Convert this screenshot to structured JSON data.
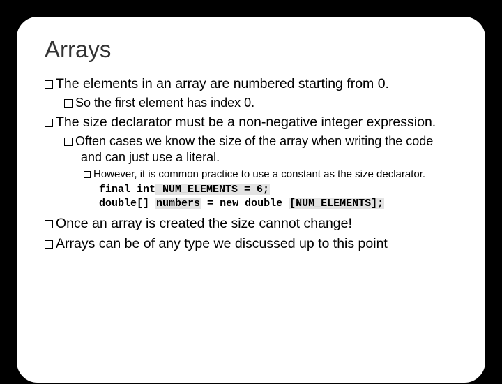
{
  "title": "Arrays",
  "items": {
    "p1": "The elements in an array are numbered starting from 0.",
    "p1a": "So the first element has index 0.",
    "p2": "The size declarator must be a non-negative integer expression.",
    "p2a": "Often cases we know the size of the array when writing the code and can just use a literal.",
    "p2a1": "However, it is common practice to use a constant as the size declarator.",
    "p3": "Once an array is created the size cannot change!",
    "p4": "Arrays can be of any type we discussed up to this point"
  },
  "code": {
    "kw1": "final int",
    "asg1": " NUM_ELEMENTS = 6;",
    "t1a": "double",
    "t1b": "[] ",
    "var1": "numbers",
    "eq": " = ",
    "kw2": "new ",
    "t2": "double ",
    "arr": "[NUM_ELEMENTS];"
  }
}
